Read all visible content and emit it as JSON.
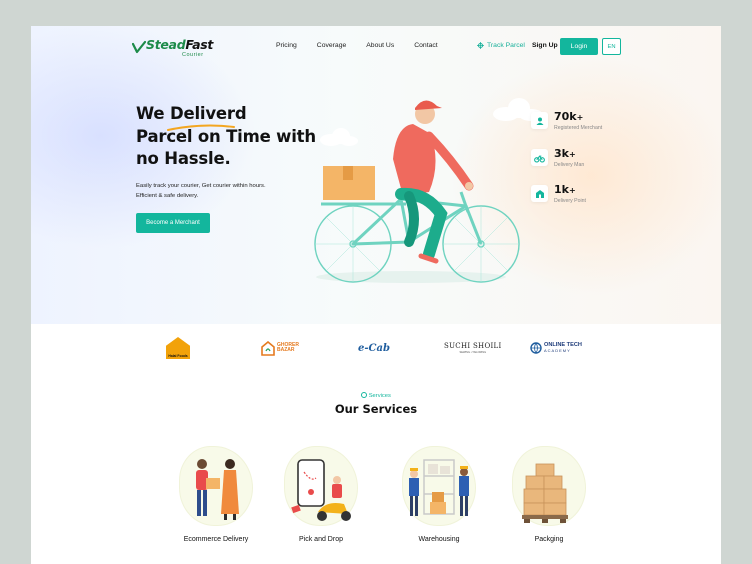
{
  "brand": {
    "name_part1": "Stead",
    "name_part2": "Fast",
    "sub": "Courier"
  },
  "nav": {
    "links": [
      "Pricing",
      "Coverage",
      "About Us",
      "Contact"
    ]
  },
  "header": {
    "track": "Track Parcel",
    "signup": "Sign Up",
    "login": "Login",
    "lang": "EN"
  },
  "hero": {
    "headline_line1_a": "We ",
    "headline_line1_b": "Deliverd",
    "headline_line2": "Parcel on Time with",
    "headline_line3": "no Hassle.",
    "subtext_line1": "Easily track your courier, Get courier within hours.",
    "subtext_line2": "Efficient & safe delivery.",
    "cta": "Become a Merchant"
  },
  "stats": [
    {
      "value": "70k",
      "plus": "+",
      "label": "Registered Merchant",
      "icon": "merchant-icon"
    },
    {
      "value": "3k",
      "plus": "+",
      "label": "Delivery Man",
      "icon": "bicycle-icon"
    },
    {
      "value": "1k",
      "plus": "+",
      "label": "Delivery Point",
      "icon": "store-icon"
    }
  ],
  "partners": {
    "p1": "Halal Foods",
    "p2_a": "GHORER",
    "p2_b": "BAZAR",
    "p3": "e-Cab",
    "p4_a": "SUCHI SHOILI",
    "p4_b": "SEWING • TAILORING",
    "p5_a": "ONLINE TECH",
    "p5_b": "ACADEMY"
  },
  "services": {
    "kicker": "Services",
    "title": "Our Services",
    "items": [
      "Ecommerce Delivery",
      "Pick and Drop",
      "Warehousing",
      "Packging"
    ]
  },
  "colors": {
    "accent": "#13b69d",
    "brand_green": "#1d8b4a",
    "rider_shirt": "#ef6a5e",
    "rider_pants": "#1dac8c",
    "parcel": "#f4b567"
  }
}
